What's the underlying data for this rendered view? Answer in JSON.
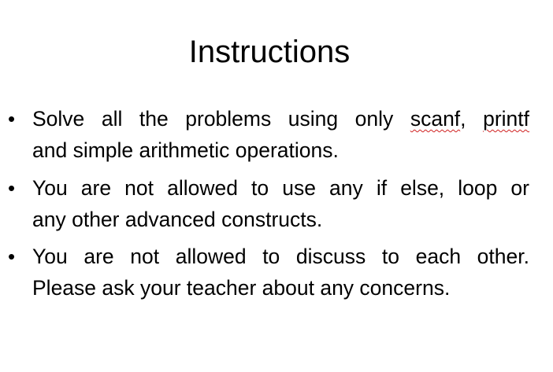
{
  "slide": {
    "title": "Instructions",
    "bullet_symbol": "•",
    "bullets": [
      {
        "line1_before": "Solve all the problems using only ",
        "spell_flag_1": "scanf",
        "line1_mid": ", ",
        "spell_flag_2": "printf",
        "line2": "and simple arithmetic operations."
      },
      {
        "line1": "You are not allowed to use any if else, loop or",
        "line2": "any other advanced constructs."
      },
      {
        "line1": "You are not allowed to discuss to each other.",
        "line2": "Please ask your teacher about any concerns."
      }
    ],
    "spellcheck_color": "#d02020"
  }
}
